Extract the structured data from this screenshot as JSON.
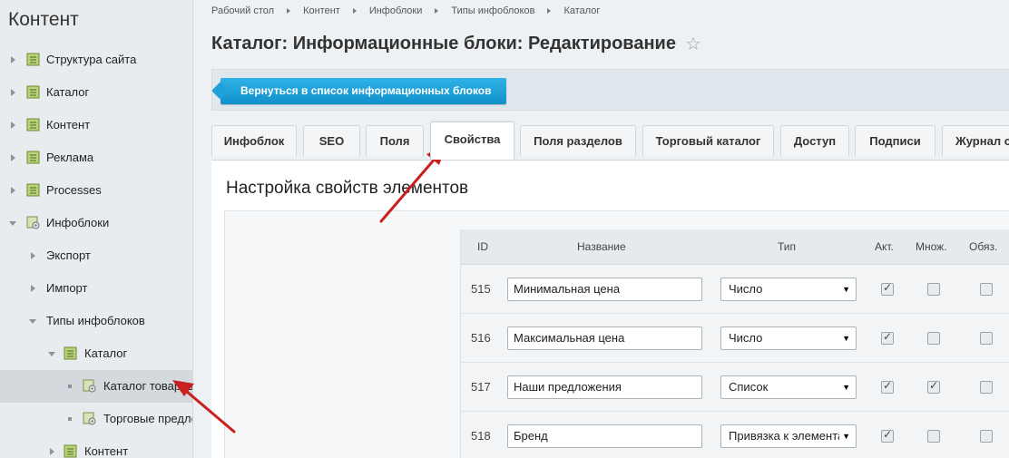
{
  "sidebar": {
    "title": "Контент",
    "items": [
      {
        "label": "Структура сайта"
      },
      {
        "label": "Каталог"
      },
      {
        "label": "Контент"
      },
      {
        "label": "Реклама"
      },
      {
        "label": "Processes"
      },
      {
        "label": "Инфоблоки"
      },
      {
        "label": "Экспорт"
      },
      {
        "label": "Импорт"
      },
      {
        "label": "Типы инфоблоков"
      },
      {
        "label": "Каталог"
      },
      {
        "label": "Каталог товаров"
      },
      {
        "label": "Торговые предложения"
      },
      {
        "label": "Контент"
      }
    ]
  },
  "breadcrumb": [
    "Рабочий стол",
    "Контент",
    "Инфоблоки",
    "Типы инфоблоков",
    "Каталог"
  ],
  "page_title": "Каталог: Информационные блоки: Редактирование",
  "toolbar": {
    "back_label": "Вернуться в список информационных блоков"
  },
  "tabs": [
    "Инфоблок",
    "SEO",
    "Поля",
    "Свойства",
    "Поля разделов",
    "Торговый каталог",
    "Доступ",
    "Подписи",
    "Журнал событий"
  ],
  "active_tab": "Свойства",
  "section_title": "Настройка свойств элементов",
  "table": {
    "headers": {
      "id": "ID",
      "name": "Название",
      "type": "Тип",
      "active": "Акт.",
      "multiple": "Множ.",
      "required": "Обяз."
    },
    "rows": [
      {
        "id": "515",
        "name": "Минимальная цена",
        "type": "Число",
        "active": true,
        "multiple": false,
        "required": false
      },
      {
        "id": "516",
        "name": "Максимальная цена",
        "type": "Число",
        "active": true,
        "multiple": false,
        "required": false
      },
      {
        "id": "517",
        "name": "Наши предложения",
        "type": "Список",
        "active": true,
        "multiple": true,
        "required": false
      },
      {
        "id": "518",
        "name": "Бренд",
        "type": "Привязка к элементам",
        "active": true,
        "multiple": false,
        "required": false
      }
    ]
  },
  "colors": {
    "accent": "#1a9ad6",
    "annotation_arrow": "#c8201f"
  }
}
